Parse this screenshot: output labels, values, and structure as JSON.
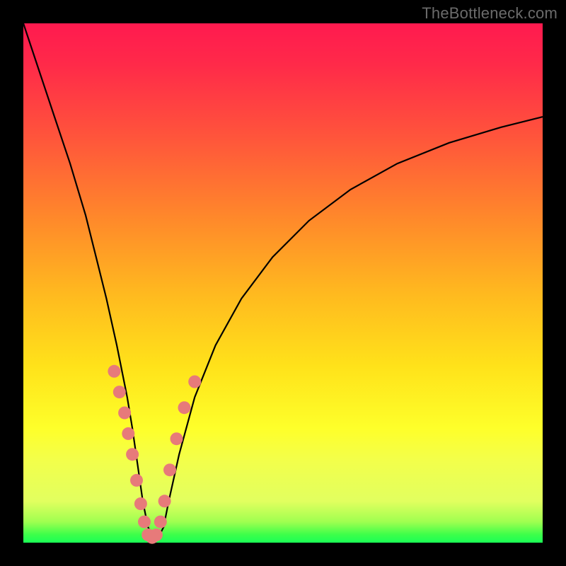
{
  "watermark": "TheBottleneck.com",
  "colors": {
    "frame": "#000000",
    "gradient_top": "#ff1a4f",
    "gradient_mid": "#ffe21a",
    "gradient_bottom": "#1aff55",
    "curve": "#000000",
    "markers": "#e77a7a"
  },
  "chart_data": {
    "type": "line",
    "title": "",
    "xlabel": "",
    "ylabel": "",
    "xlim": [
      0,
      100
    ],
    "ylim": [
      0,
      100
    ],
    "series": [
      {
        "name": "bottleneck-curve",
        "x": [
          0,
          3,
          6,
          9,
          12,
          14,
          16,
          18,
          20,
          21,
          22,
          23,
          24,
          25,
          26,
          27,
          28,
          30,
          33,
          37,
          42,
          48,
          55,
          63,
          72,
          82,
          92,
          100
        ],
        "y": [
          100,
          91,
          82,
          73,
          63,
          55,
          47,
          38,
          28,
          22,
          15,
          8,
          3,
          1,
          1,
          3,
          8,
          17,
          28,
          38,
          47,
          55,
          62,
          68,
          73,
          77,
          80,
          82
        ]
      }
    ],
    "markers": {
      "name": "highlighted-points",
      "x": [
        17.5,
        18.5,
        19.5,
        20.2,
        21.0,
        21.8,
        22.6,
        23.3,
        24.0,
        24.8,
        25.6,
        26.4,
        27.2,
        28.2,
        29.5,
        31.0,
        33.0
      ],
      "y": [
        33.0,
        29.0,
        25.0,
        21.0,
        17.0,
        12.0,
        7.5,
        4.0,
        1.5,
        1.0,
        1.5,
        4.0,
        8.0,
        14.0,
        20.0,
        26.0,
        31.0
      ]
    }
  }
}
